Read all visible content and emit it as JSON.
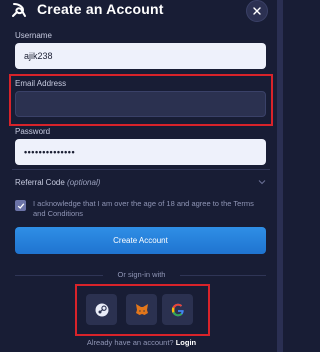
{
  "header": {
    "title": "Create an Account"
  },
  "form": {
    "username": {
      "label": "Username",
      "value": "ajik238"
    },
    "email": {
      "label": "Email Address",
      "value": ""
    },
    "password": {
      "label": "Password",
      "value": "••••••••••••••"
    },
    "referral": {
      "label": "Referral Code",
      "optional": "(optional)"
    },
    "terms": {
      "checked": true,
      "text": "I acknowledge that I am over the age of 18 and agree to the Terms and Conditions"
    },
    "submit_label": "Create Account"
  },
  "signin": {
    "divider_text": "Or sign-in with",
    "providers": [
      {
        "name": "Steam",
        "icon": "steam-icon"
      },
      {
        "name": "MetaMask",
        "icon": "metamask-icon"
      },
      {
        "name": "Google",
        "icon": "google-icon"
      }
    ]
  },
  "footer": {
    "prompt": "Already have an account?",
    "link": "Login"
  },
  "colors": {
    "background": "#181d35",
    "accent": "#1f74d0",
    "highlight": "#d8232a"
  }
}
